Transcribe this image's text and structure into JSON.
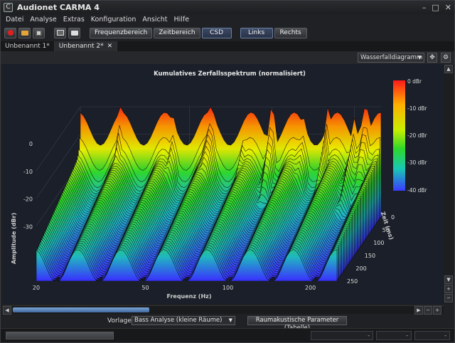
{
  "window": {
    "title": "Audionet CARMA 4",
    "app_icon_glyph": "C",
    "minimize": "–",
    "maximize": "□",
    "close": "✕"
  },
  "menu": [
    {
      "label": "Datei"
    },
    {
      "label": "Analyse"
    },
    {
      "label": "Extras"
    },
    {
      "label": "Konfiguration"
    },
    {
      "label": "Ansicht"
    },
    {
      "label": "Hilfe"
    }
  ],
  "toolbar": {
    "icons": [
      "record-icon",
      "open-folder-icon",
      "save-icon",
      "screenshot-icon",
      "print-icon"
    ],
    "frequency_range": "Frequenzbereich",
    "time_range": "Zeitbereich",
    "csd": "CSD",
    "left": "Links",
    "right": "Rechts"
  },
  "tabs": [
    {
      "label": "Unbenannt 1*"
    },
    {
      "label": "Unbenannt 2*",
      "close": "✕"
    }
  ],
  "view": {
    "selected": "Wasserfalldiagramm"
  },
  "chart_data": {
    "type": "area",
    "title": "Kumulatives Zerfallsspektrum (normalisiert)",
    "xlabel": "Frequenz (Hz)",
    "ylabel": "Amplitude (dBr)",
    "zlabel": "Zeit (ms)",
    "x_ticks": [
      "20",
      "50",
      "100",
      "200"
    ],
    "y_ticks": [
      "0",
      "-10",
      "-20",
      "-30"
    ],
    "z_ticks": [
      "0",
      "50",
      "100",
      "150",
      "200",
      "250"
    ],
    "colorbar_ticks": [
      "0 dBr",
      "-10 dBr",
      "-20 dBr",
      "-30 dBr",
      "-40 dBr"
    ],
    "colorbar_colors": [
      "#ff1a1a",
      "#ffd000",
      "#3cdc1e",
      "#18c8b4",
      "#3a3cff"
    ],
    "x_scale": "log",
    "x_range": [
      20,
      250
    ],
    "y_range": [
      -40,
      0
    ],
    "z_range": [
      0,
      250
    ],
    "peaks_hz": [
      28,
      44,
      60,
      80,
      100,
      130,
      160,
      200,
      220
    ],
    "grid": true
  },
  "bottom": {
    "templates_label": "Vorlagen",
    "template_selected": "Bass Analyse (kleine Räume)",
    "room_params_button": "Raumakustische Parameter (Tabelle)"
  },
  "status": {
    "field1": "-",
    "field2": "-",
    "field3": "-"
  }
}
